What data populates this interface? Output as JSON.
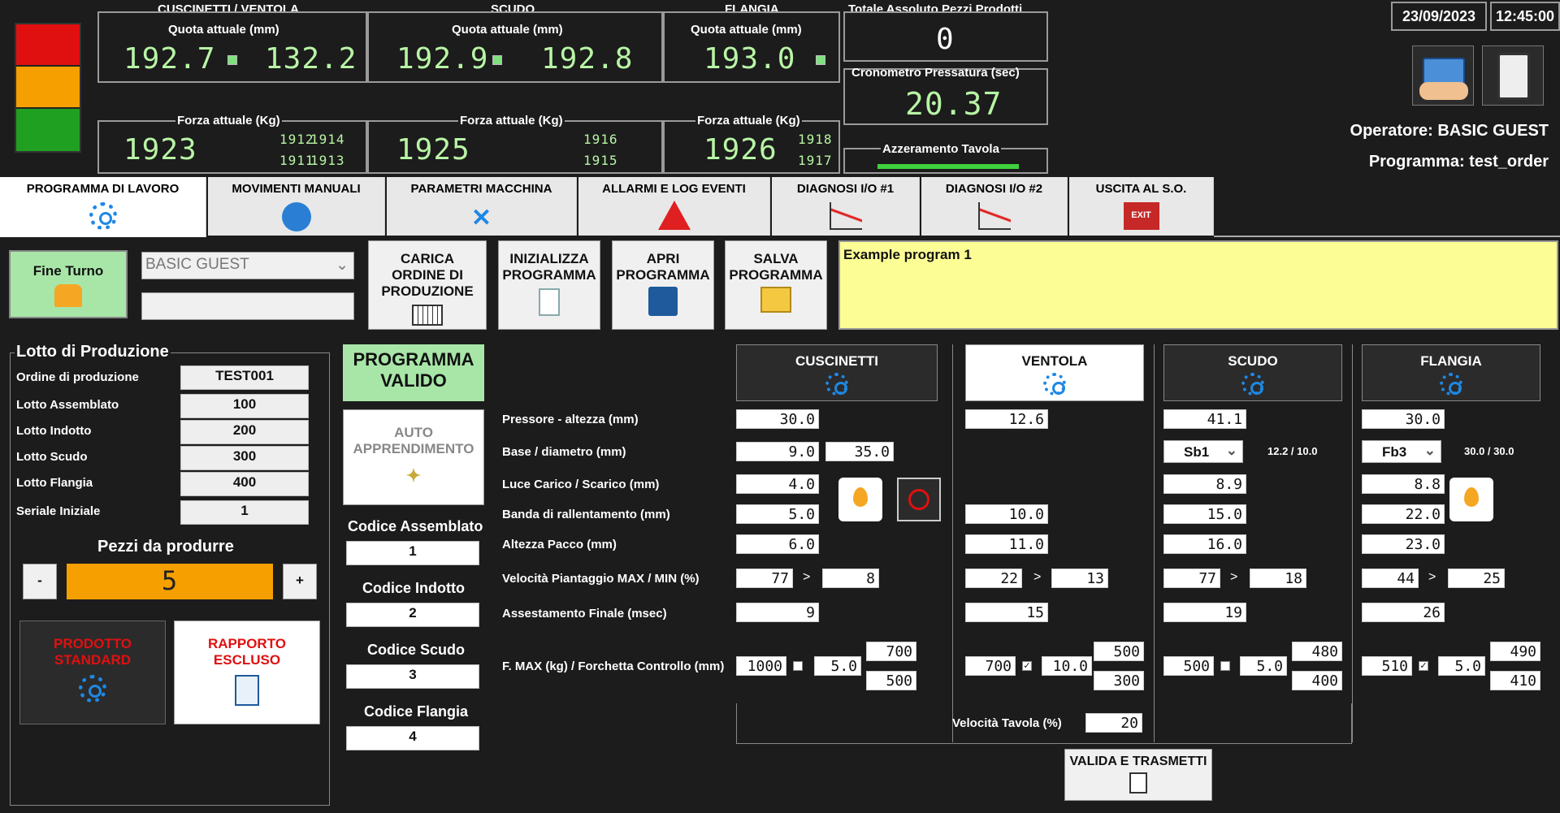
{
  "header": {
    "cuscinetti_ventola": "CUSCINETTI / VENTOLA",
    "scudo": "SCUDO",
    "flangia": "FLANGIA",
    "quota_label": "Quota attuale (mm)",
    "forza_label": "Forza attuale (Kg)",
    "cv_quota1": "192.7",
    "cv_quota2": "132.2",
    "cv_forza": "1923",
    "cv_f1": "1912",
    "cv_f2": "1914",
    "cv_f3": "1911",
    "cv_f4": "1913",
    "sc_quota1": "192.9",
    "sc_quota2": "192.8",
    "sc_forza": "1925",
    "sc_f1": "1916",
    "sc_f2": "1915",
    "fl_quota": "193.0",
    "fl_forza": "1926",
    "fl_f1": "1918",
    "fl_f2": "1917",
    "totale_label": "Totale Assoluto Pezzi Prodotti",
    "totale_value": "0",
    "cronometro_label": "Cronometro Pressatura (sec)",
    "cronometro_value": "20.37",
    "azzeramento_label": "Azzeramento Tavola",
    "date": "23/09/2023",
    "time": "12:45:00",
    "operatore": "Operatore: BASIC GUEST",
    "programma": "Programma: test_order"
  },
  "tabs": [
    "PROGRAMMA DI LAVORO",
    "MOVIMENTI MANUALI",
    "PARAMETRI MACCHINA",
    "ALLARMI E LOG EVENTI",
    "DIAGNOSI I/O #1",
    "DIAGNOSI I/O #2",
    "USCITA AL S.O."
  ],
  "toolbar": {
    "fine_turno": "Fine Turno",
    "operator_select": "BASIC GUEST",
    "carica": "CARICA ORDINE DI PRODUZIONE",
    "inizializza": "INIZIALIZZA PROGRAMMA",
    "apri": "APRI PROGRAMMA",
    "salva": "SALVA PROGRAMMA",
    "notes": "Example program 1"
  },
  "lotto": {
    "title": "Lotto di Produzione",
    "rows": [
      {
        "label": "Ordine di produzione",
        "value": "TEST001"
      },
      {
        "label": "Lotto Assemblato",
        "value": "100"
      },
      {
        "label": "Lotto Indotto",
        "value": "200"
      },
      {
        "label": "Lotto Scudo",
        "value": "300"
      },
      {
        "label": "Lotto Flangia",
        "value": "400"
      },
      {
        "label": "Seriale Iniziale",
        "value": "1"
      }
    ],
    "pezzi_label": "Pezzi da produrre",
    "pezzi_value": "5",
    "minus": "-",
    "plus": "+",
    "prodotto": "PRODOTTO STANDARD",
    "rapporto": "RAPPORTO ESCLUSO"
  },
  "codici": {
    "programma_valido": "PROGRAMMA VALIDO",
    "auto": "AUTO APPRENDIMENTO",
    "items": [
      {
        "label": "Codice Assemblato",
        "value": "1"
      },
      {
        "label": "Codice Indotto",
        "value": "2"
      },
      {
        "label": "Codice Scudo",
        "value": "3"
      },
      {
        "label": "Codice Flangia",
        "value": "4"
      }
    ]
  },
  "params": {
    "labels": [
      "Pressore - altezza (mm)",
      "Base / diametro (mm)",
      "Luce Carico / Scarico (mm)",
      "Banda di rallentamento (mm)",
      "Altezza Pacco (mm)",
      "Velocità Piantaggio MAX / MIN (%)",
      "Assestamento Finale (msec)",
      "F. MAX (kg) / Forchetta Controllo (mm)"
    ],
    "sections": [
      "CUSCINETTI",
      "VENTOLA",
      "SCUDO",
      "FLANGIA"
    ],
    "cus": {
      "pressore": "30.0",
      "base": "9.0",
      "diam": "35.0",
      "luce": "4.0",
      "banda": "5.0",
      "pacco": "6.0",
      "vmax": "77",
      "vmin": "8",
      "ass": "9",
      "fmax": "1000",
      "forch": "5.0",
      "f_hi": "700",
      "f_lo": "500"
    },
    "ven": {
      "pressore": "12.6",
      "banda": "10.0",
      "pacco": "11.0",
      "vmax": "22",
      "vmin": "13",
      "ass": "15",
      "fmax": "700",
      "forch": "10.0",
      "f_hi": "500",
      "f_lo": "300"
    },
    "scu": {
      "pressore": "41.1",
      "base": "Sb1",
      "base_info": "12.2 / 10.0",
      "luce": "8.9",
      "banda": "15.0",
      "pacco": "16.0",
      "vmax": "77",
      "vmin": "18",
      "ass": "19",
      "fmax": "500",
      "forch": "5.0",
      "f_hi": "480",
      "f_lo": "400"
    },
    "fla": {
      "pressore": "30.0",
      "base": "Fb3",
      "base_info": "30.0 / 30.0",
      "luce": "8.8",
      "banda": "22.0",
      "pacco": "23.0",
      "vmax": "44",
      "vmin": "25",
      "ass": "26",
      "fmax": "510",
      "forch": "5.0",
      "f_hi": "490",
      "f_lo": "410"
    },
    "velocita_label": "Velocità Tavola (%)",
    "velocita_value": "20",
    "valida": "VALIDA E TRASMETTI",
    "gt": ">"
  },
  "colors": {
    "red": "#e01010",
    "orange": "#f5a000",
    "green": "#20a020",
    "valid_bg": "#a8e6a8",
    "notes_bg": "#fdfd96",
    "pezzi_bg": "#f5a000"
  }
}
